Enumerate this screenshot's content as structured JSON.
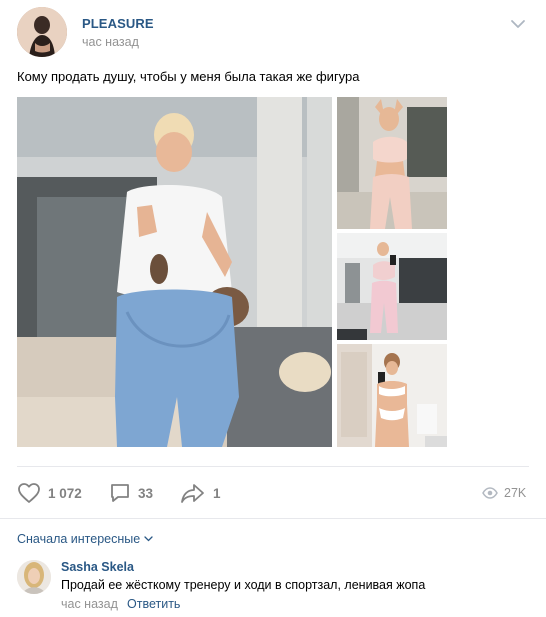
{
  "post": {
    "group_name": "PLEASURE",
    "time": "час назад",
    "text": "Кому продать душу, чтобы у меня была такая же фигура",
    "photos": [
      {
        "id": "main"
      },
      {
        "id": "thumb-1"
      },
      {
        "id": "thumb-2"
      },
      {
        "id": "thumb-3"
      }
    ]
  },
  "actions": {
    "likes": "1 072",
    "comments": "33",
    "shares": "1",
    "views": "27K"
  },
  "comments_section": {
    "sort_label": "Сначала интересные",
    "items": [
      {
        "author": "Sasha Skela",
        "text": "Продай ее жёсткому тренеру и ходи в спортзал, ленивая жопа",
        "time": "час назад",
        "reply_label": "Ответить"
      }
    ]
  },
  "icons": {
    "chevron": "chevron-down-icon",
    "like": "heart-icon",
    "comment": "comment-icon",
    "share": "share-icon",
    "views": "eye-icon",
    "sort": "chevron-down-icon"
  },
  "colors": {
    "link": "#2a5885",
    "muted": "#939393",
    "icon": "#828282",
    "divider": "#e7e8ec"
  }
}
